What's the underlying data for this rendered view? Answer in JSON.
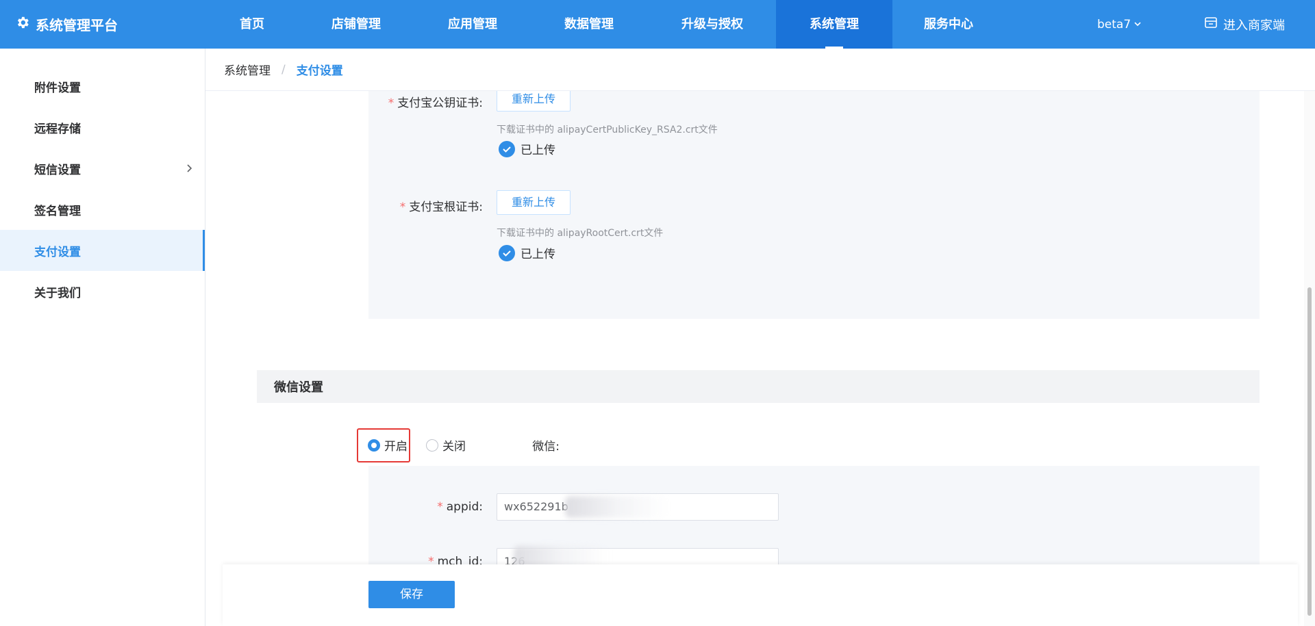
{
  "header": {
    "brand": "系统管理平台",
    "nav": [
      "首页",
      "店铺管理",
      "应用管理",
      "数据管理",
      "升级与授权",
      "系统管理",
      "服务中心"
    ],
    "active_nav": "系统管理",
    "version": "beta7",
    "enter_merchant": "进入商家端"
  },
  "sidebar": {
    "items": [
      "附件设置",
      "远程存储",
      "短信设置",
      "签名管理",
      "支付设置",
      "关于我们"
    ],
    "active": "支付设置"
  },
  "breadcrumb": {
    "parent": "系统管理",
    "separator": "/",
    "current": "支付设置"
  },
  "alipay": {
    "public_cert": {
      "label": "支付宝公钥证书:",
      "button": "重新上传",
      "hint": "下载证书中的 alipayCertPublicKey_RSA2.crt文件",
      "status": "已上传"
    },
    "root_cert": {
      "label": "支付宝根证书:",
      "button": "重新上传",
      "hint": "下载证书中的 alipayRootCert.crt文件",
      "status": "已上传"
    }
  },
  "wechat": {
    "section_title": "微信设置",
    "toggle_label": "微信:",
    "option_on": "开启",
    "option_off": "关闭",
    "selected": "开启",
    "appid_label": "appid:",
    "appid_value": "wx652291b",
    "mch_id_label": "mch_id:",
    "mch_id_value": "126"
  },
  "footer": {
    "save": "保存"
  },
  "colors": {
    "primary": "#2f8de6",
    "required": "#f56c6c",
    "highlight": "#e53935"
  }
}
